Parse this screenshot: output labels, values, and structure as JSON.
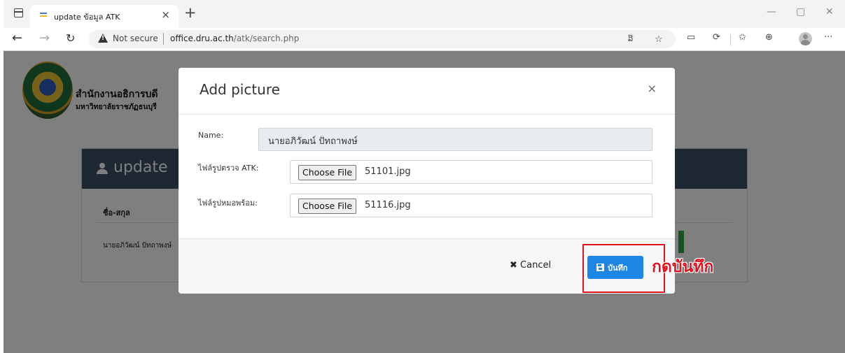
{
  "browser": {
    "tab_title": "update ข้อมูล ATK",
    "tab_close_icon": "×",
    "new_tab_icon": "+",
    "not_secure": "Not secure",
    "url_domain": "office.dru.ac.th",
    "url_path": "/atk/search.php",
    "toolbar_read_aloud": "ລ໊",
    "window_minimize": "—",
    "window_restore": "▢",
    "window_close": "✕",
    "more_menu": "···"
  },
  "site": {
    "org_name": "สำนักงานอธิการบดี",
    "org_sub": "มหาวิทยาลัยราชภัฏธนบุรี"
  },
  "panel": {
    "title": "update",
    "column_name": "ชื่อ-สกุล",
    "row_name": "นายอภิวัฒน์ ปัทถาพงษ์"
  },
  "modal": {
    "title": "Add picture",
    "close_icon": "×",
    "name_label": "Name:",
    "name_value": "นายอภิวัฒน์ ปัทถาพงษ์",
    "atk_label": "ไฟล์รูปตรวจ ATK:",
    "atk_button": "Choose File",
    "atk_file": "51101.jpg",
    "doctor_label": "ไฟล์รูปหมอพร้อม:",
    "doctor_button": "Choose File",
    "doctor_file": "51116.jpg",
    "cancel_icon": "✖",
    "cancel_label": "Cancel",
    "save_label": "บันทึก"
  },
  "annotation": {
    "text": "กดบันทึก",
    "color": "#e0131e"
  },
  "colors": {
    "panel_header": "#3c5066",
    "save_button": "#1b86e6"
  }
}
